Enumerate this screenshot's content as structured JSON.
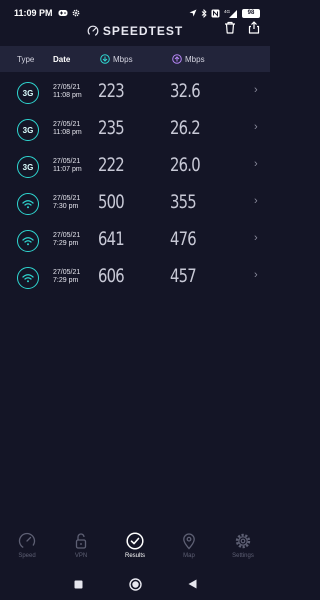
{
  "status_bar": {
    "time": "11:09 PM",
    "network": "4G",
    "battery": "98"
  },
  "header": {
    "app_name": "SPEEDTEST",
    "icons": [
      "gauge-icon",
      "trash-icon",
      "share-icon"
    ]
  },
  "table": {
    "columns": {
      "type": "Type",
      "date": "Date",
      "download": "Mbps",
      "upload": "Mbps"
    },
    "rows": [
      {
        "type": "3G",
        "kind": "cellular",
        "date": "27/05/21",
        "time": "11:08 pm",
        "download": "223",
        "upload": "32.6"
      },
      {
        "type": "3G",
        "kind": "cellular",
        "date": "27/05/21",
        "time": "11:08 pm",
        "download": "235",
        "upload": "26.2"
      },
      {
        "type": "3G",
        "kind": "cellular",
        "date": "27/05/21",
        "time": "11:07 pm",
        "download": "222",
        "upload": "26.0"
      },
      {
        "type": "",
        "kind": "wifi",
        "date": "27/05/21",
        "time": "7:30 pm",
        "download": "500",
        "upload": "355"
      },
      {
        "type": "",
        "kind": "wifi",
        "date": "27/05/21",
        "time": "7:29 pm",
        "download": "641",
        "upload": "476"
      },
      {
        "type": "",
        "kind": "wifi",
        "date": "27/05/21",
        "time": "7:29 pm",
        "download": "606",
        "upload": "457"
      }
    ]
  },
  "bottom_nav": [
    {
      "label": "Speed",
      "icon": "speedometer-icon",
      "active": false
    },
    {
      "label": "VPN",
      "icon": "lock-icon",
      "active": false
    },
    {
      "label": "Results",
      "icon": "checkmark-circle-icon",
      "active": true
    },
    {
      "label": "Map",
      "icon": "map-pin-icon",
      "active": false
    },
    {
      "label": "Settings",
      "icon": "gear-icon",
      "active": false
    }
  ],
  "colors": {
    "background": "#141526",
    "header_band": "#22243a",
    "accent_cyan": "#2fd7d1",
    "accent_purple": "#b585f5",
    "inactive": "#5e6074"
  }
}
